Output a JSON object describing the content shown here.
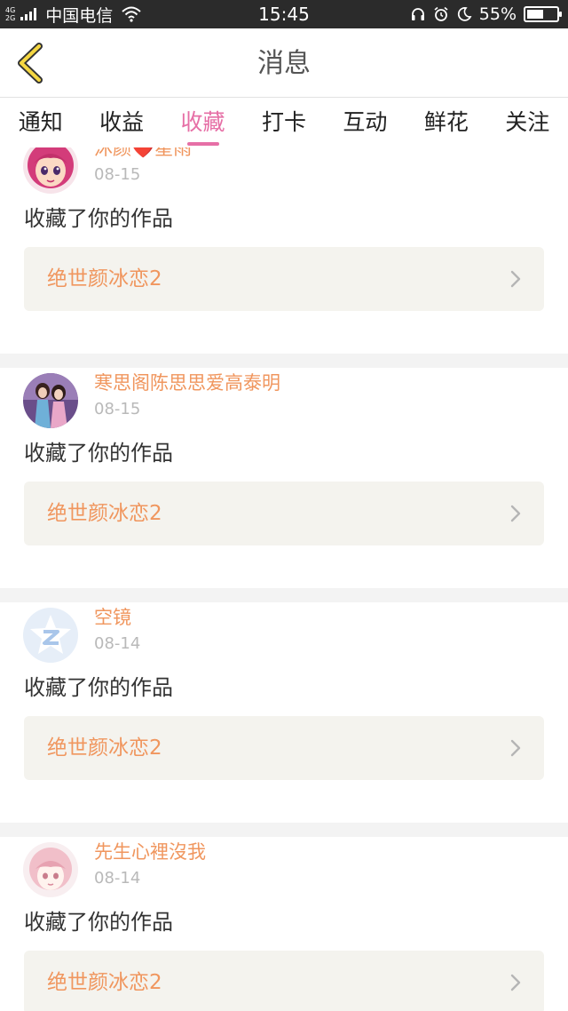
{
  "status_bar": {
    "network_top": "4G",
    "network_bottom": "2G",
    "carrier": "中国电信",
    "time": "15:45",
    "battery_percent": "55%",
    "battery_level": 0.55
  },
  "header": {
    "title": "消息"
  },
  "tabs": [
    {
      "label": "通知",
      "active": false
    },
    {
      "label": "收益",
      "active": false
    },
    {
      "label": "收藏",
      "active": true
    },
    {
      "label": "打卡",
      "active": false
    },
    {
      "label": "互动",
      "active": false
    },
    {
      "label": "鲜花",
      "active": false
    },
    {
      "label": "关注",
      "active": false
    }
  ],
  "colors": {
    "accent": "#e66fa6",
    "username": "#f0965e",
    "work_bg": "#f4f3ee"
  },
  "messages": [
    {
      "username": "沐颜❤️星雨",
      "date": "08-15",
      "action": "收藏了你的作品",
      "work_title": "绝世颜冰恋2",
      "avatar_icon": "cartoon-girl-avatar"
    },
    {
      "username": "寒思阁陈思思爱高泰明",
      "date": "08-15",
      "action": "收藏了你的作品",
      "work_title": "绝世颜冰恋2",
      "avatar_icon": "two-girls-photo-avatar"
    },
    {
      "username": "空镜",
      "date": "08-14",
      "action": "收藏了你的作品",
      "work_title": "绝世颜冰恋2",
      "avatar_icon": "default-qzone-avatar"
    },
    {
      "username": "先生心裡沒我",
      "date": "08-14",
      "action": "收藏了你的作品",
      "work_title": "绝世颜冰恋2",
      "avatar_icon": "anime-pink-hair-avatar"
    }
  ]
}
